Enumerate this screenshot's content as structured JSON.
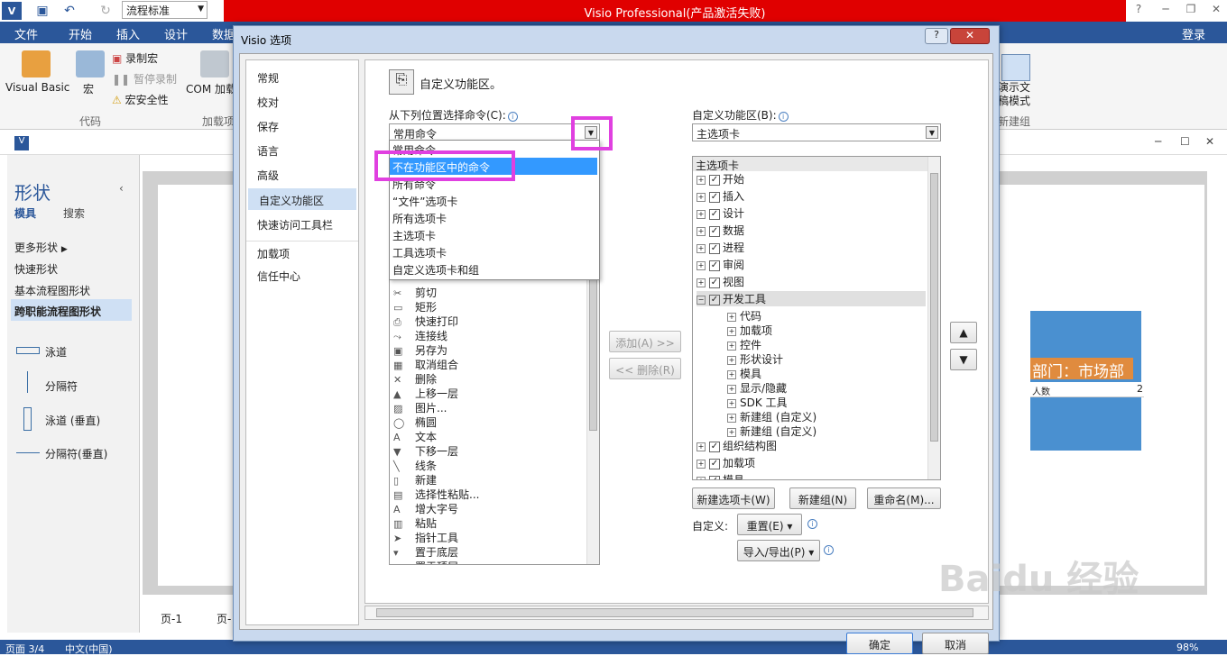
{
  "titlebar": {
    "title": "Visio Professional(产品激活失败)",
    "flow_select": "流程标准",
    "login": "登录"
  },
  "ribbon": {
    "tabs": [
      "文件",
      "开始",
      "插入",
      "设计",
      "数据"
    ],
    "visual_basic": "Visual Basic",
    "macro": "宏",
    "record_macro": "录制宏",
    "pause_record": "暂停录制",
    "macro_security": "宏安全性",
    "group_code": "代码",
    "com_addins": "COM 加载",
    "group_addins": "加载项",
    "demo_mode": "演示文稿模式",
    "group_new": "新建组"
  },
  "shapes_panel": {
    "title": "形状",
    "tab_stencils": "模具",
    "tab_search": "搜索",
    "items": [
      "更多形状",
      "快速形状",
      "基本流程图形状",
      "跨职能流程图形状"
    ],
    "shapes": [
      "泳道",
      "分隔符",
      "泳道 (垂直)",
      "分隔符(垂直)"
    ]
  },
  "canvas": {
    "page_tab": "页-1",
    "page_tab2": "页-",
    "swimlane_label": "部门：市场部",
    "people_label": "人数",
    "people_count": "2"
  },
  "statusbar": {
    "page": "页面 3/4",
    "lang": "中文(中国)",
    "zoom": "98%"
  },
  "dialog": {
    "title": "Visio 选项",
    "nav": [
      "常规",
      "校对",
      "保存",
      "语言",
      "高级",
      "自定义功能区",
      "快速访问工具栏",
      "加载项",
      "信任中心"
    ],
    "nav_selected": "自定义功能区",
    "heading": "自定义功能区。",
    "choose_from_label": "从下列位置选择命令(C):",
    "choose_from_value": "常用命令",
    "dropdown_items": [
      "常用命令",
      "不在功能区中的命令",
      "所有命令",
      "“文件”选项卡",
      "所有选项卡",
      "主选项卡",
      "工具选项卡",
      "自定义选项卡和组"
    ],
    "dropdown_highlight": "不在功能区中的命令",
    "commands": [
      "剪切",
      "矩形",
      "快速打印",
      "连接线",
      "另存为",
      "取消组合",
      "删除",
      "上移一层",
      "图片...",
      "椭圆",
      "文本",
      "下移一层",
      "线条",
      "新建",
      "选择性粘贴...",
      "增大字号",
      "粘贴",
      "指针工具",
      "置于底层",
      "置于顶层"
    ],
    "command_icons": [
      "✂",
      "▭",
      "⎙",
      "⤳",
      "▣",
      "▦",
      "✕",
      "▲",
      "▨",
      "◯",
      "A",
      "▼",
      "╲",
      "▯",
      "▤",
      "A",
      "▥",
      "➤",
      "▾",
      "▴"
    ],
    "add_button": "添加(A) >>",
    "remove_button": "<< 删除(R)",
    "customize_ribbon_label": "自定义功能区(B):",
    "customize_ribbon_value": "主选项卡",
    "tree_header": "主选项卡",
    "tree_top": [
      "开始",
      "插入",
      "设计",
      "数据",
      "进程",
      "审阅",
      "视图",
      "开发工具"
    ],
    "tree_dev_children": [
      "代码",
      "加载项",
      "控件",
      "形状设计",
      "模具",
      "显示/隐藏",
      "SDK 工具",
      "新建组 (自定义)",
      "新建组 (自定义)"
    ],
    "tree_bottom": [
      "组织结构图",
      "加载项",
      "模具"
    ],
    "new_tab_button": "新建选项卡(W)",
    "new_group_button": "新建组(N)",
    "rename_button": "重命名(M)...",
    "customize_label": "自定义:",
    "reset_button": "重置(E) ▾",
    "import_export_button": "导入/导出(P) ▾",
    "ok_button": "确定",
    "cancel_button": "取消"
  },
  "watermark": "Baidu 经验"
}
